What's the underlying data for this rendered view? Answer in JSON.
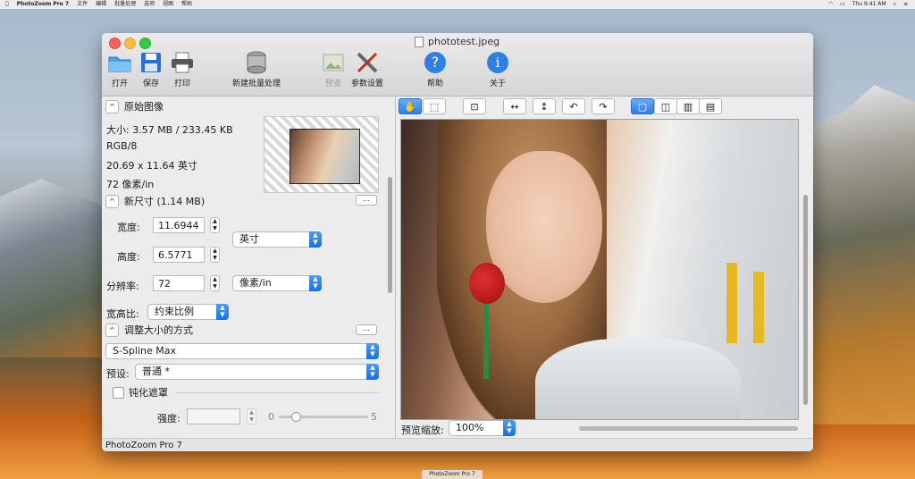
{
  "menubar": {
    "app": "PhotoZoom Pro 7",
    "items": [
      "文件",
      "编辑",
      "批量处理",
      "选项",
      "视图",
      "帮助"
    ],
    "clock": "Thu 9:41 AM"
  },
  "window": {
    "title": "phototest.jpeg"
  },
  "toolbar": {
    "open": "打开",
    "save": "保存",
    "print": "打印",
    "batch": "新建批量处理",
    "preview": "预览",
    "settings": "参数设置",
    "help": "帮助",
    "about": "关于"
  },
  "original": {
    "header": "原始图像",
    "size": "大小: 3.57 MB / 233.45 KB",
    "mode": "RGB/8",
    "dims": "20.69 x 11.64 英寸",
    "res": "72 像素/in"
  },
  "newsize": {
    "header": "新尺寸 (1.14 MB)",
    "width_label": "宽度:",
    "width_value": "11.6944",
    "height_label": "高度:",
    "height_value": "6.5771",
    "unit": "英寸",
    "res_label": "分辨率:",
    "res_value": "72",
    "res_unit": "像素/in",
    "ratio_label": "宽高比:",
    "ratio_value": "约束比例"
  },
  "resize": {
    "header": "调整大小的方式",
    "method": "S-Spline Max",
    "preset_label": "预设:",
    "preset_value": "普通 *",
    "unsharp": "钝化遮罩",
    "strength_label": "强度:",
    "slider_min": "0",
    "slider_max": "5"
  },
  "more": "...",
  "preview": {
    "zoom_label": "预览缩放:",
    "zoom_value": "100%"
  },
  "status": "PhotoZoom Pro 7",
  "dock_label": "PhotoZoom Pro 7"
}
